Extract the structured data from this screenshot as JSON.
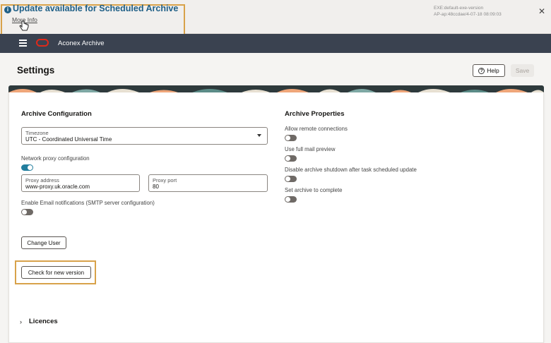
{
  "banner": {
    "title": "Update available for Scheduled Archive",
    "more_info": "More Info",
    "version_line1": "EXE:default-exe-version",
    "version_line2": "AP-ap:48ccdae/4-07-18 08:09:03",
    "info_glyph": "i",
    "close_glyph": "✕"
  },
  "header": {
    "app_title": "Aconex Archive"
  },
  "page": {
    "title": "Settings",
    "help_label": "Help",
    "help_glyph": "?",
    "save_label": "Save"
  },
  "archive_config": {
    "title": "Archive Configuration",
    "timezone_label": "Timezone",
    "timezone_value": "UTC - Coordinated Universal Time",
    "proxy_label": "Network proxy configuration",
    "proxy_enabled": true,
    "proxy_address_label": "Proxy address",
    "proxy_address_value": "www-proxy.uk.oracle.com",
    "proxy_port_label": "Proxy port",
    "proxy_port_value": "80",
    "email_label": "Enable Email notifications (SMTP server configuration)",
    "email_enabled": false,
    "change_user_label": "Change User",
    "check_version_label": "Check for new version"
  },
  "archive_properties": {
    "title": "Archive Properties",
    "items": [
      {
        "label": "Allow remote connections",
        "enabled": false
      },
      {
        "label": "Use full mail preview",
        "enabled": false
      },
      {
        "label": "Disable archive shutdown after task scheduled update",
        "enabled": false
      },
      {
        "label": "Set archive to complete",
        "enabled": false
      }
    ]
  },
  "licences": {
    "label": "Licences",
    "glyph": "›"
  },
  "colors": {
    "accent": "#227e9e",
    "banner_title": "#1f5f86",
    "highlight": "#d8a24a",
    "header_bg": "#3a4250"
  }
}
